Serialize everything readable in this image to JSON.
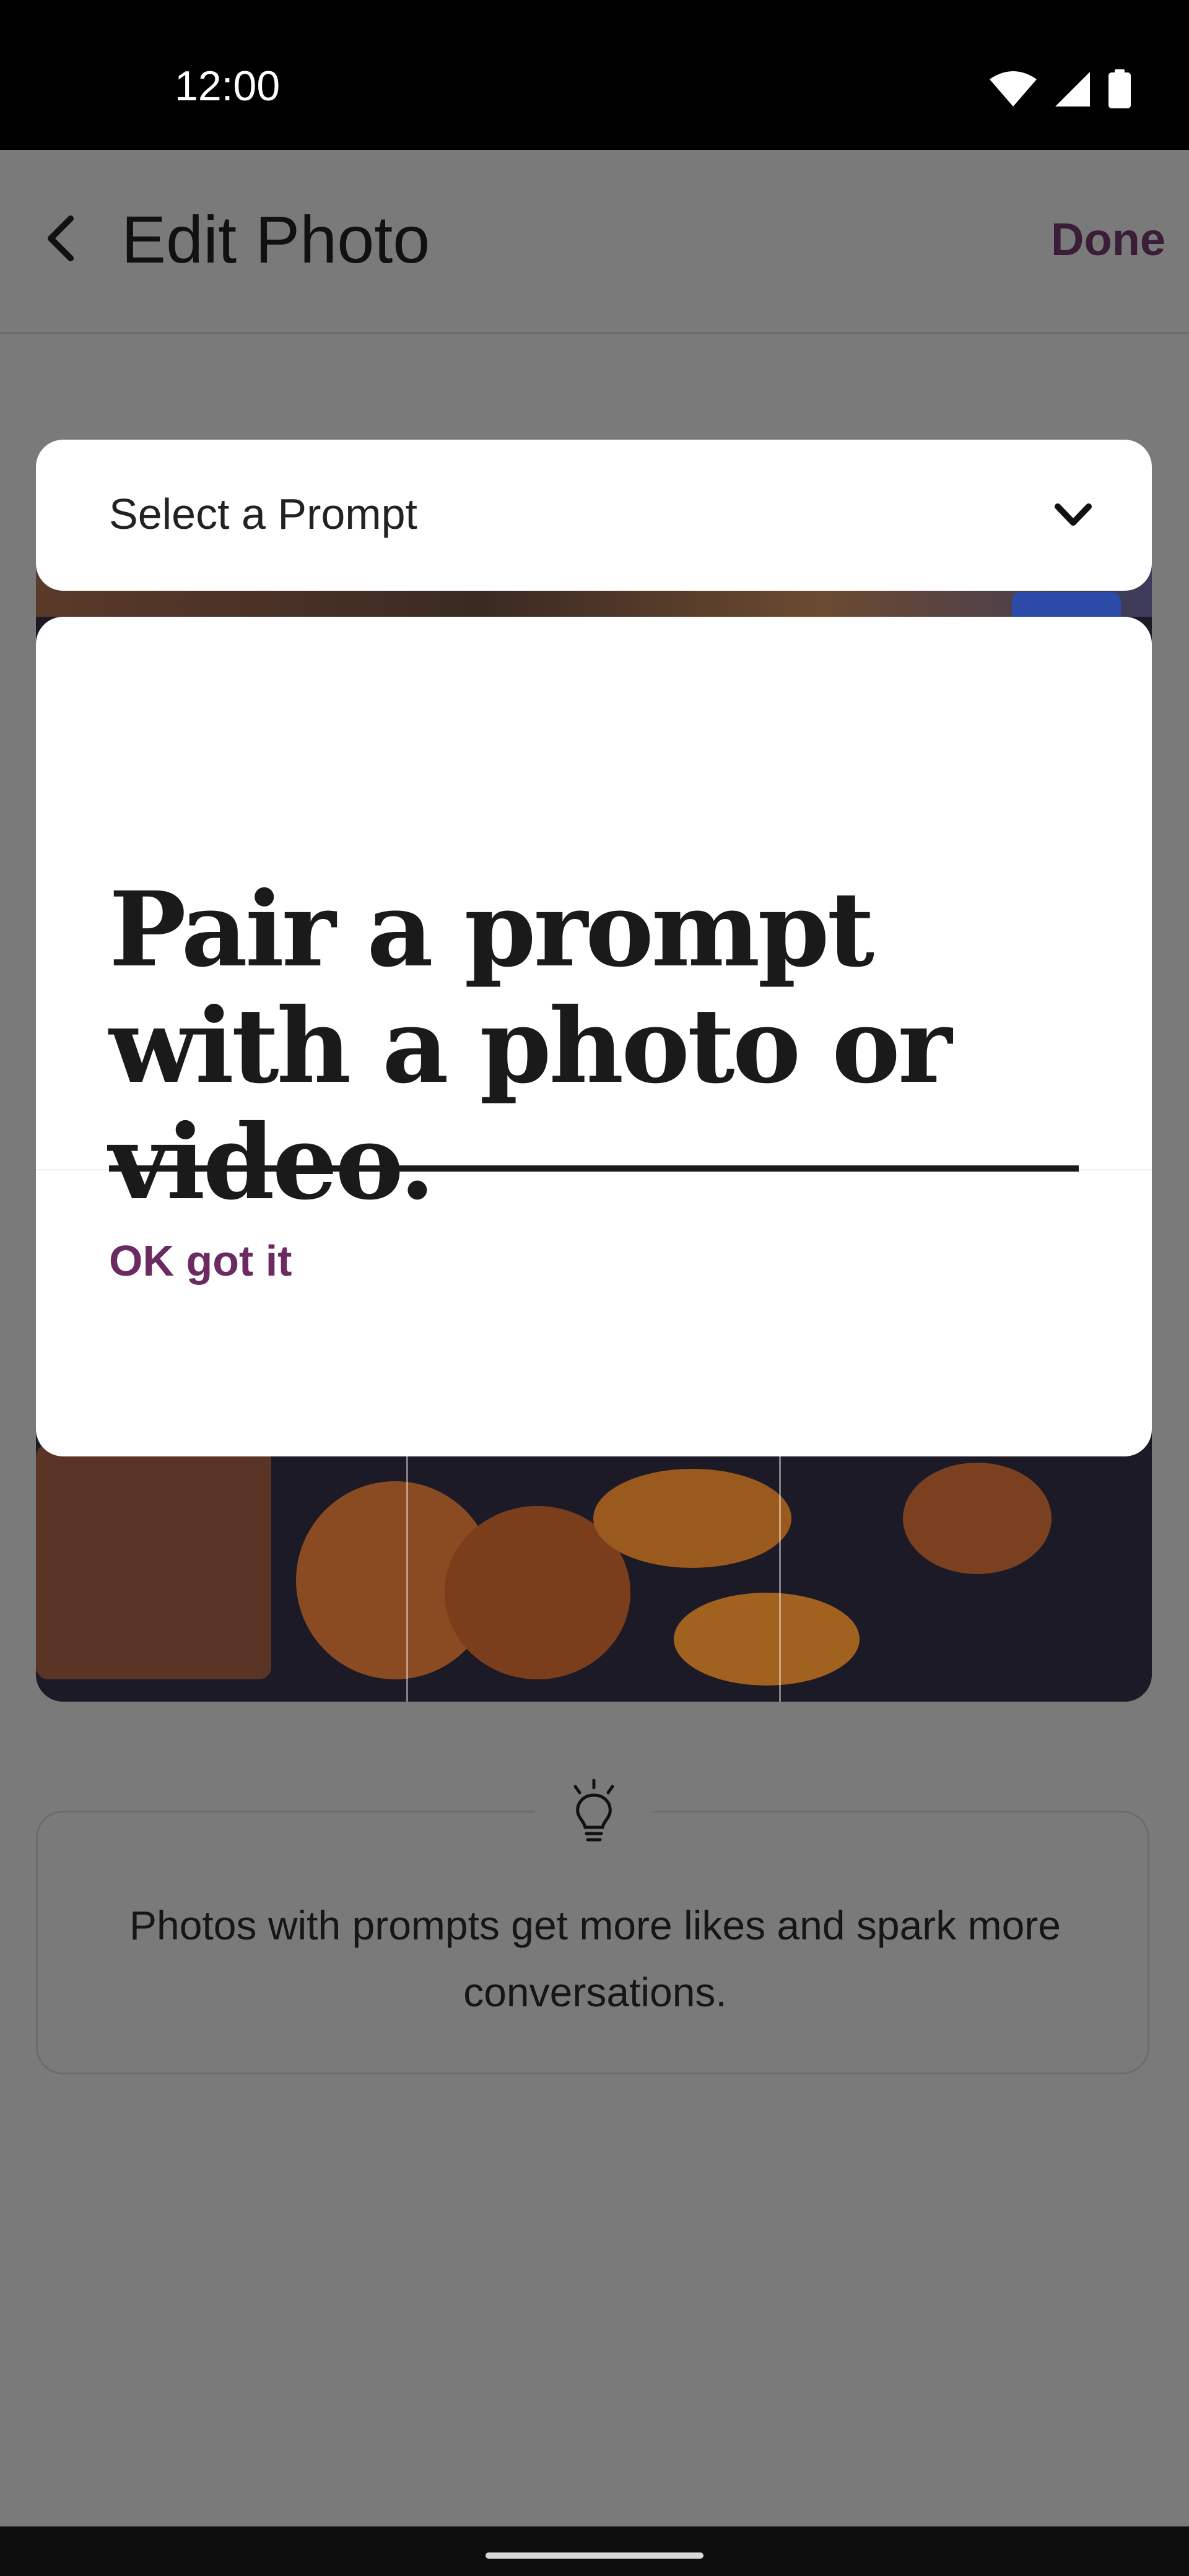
{
  "status_bar": {
    "time": "12:00",
    "icons": [
      "wifi-icon",
      "cell-signal-icon",
      "battery-icon"
    ]
  },
  "app_bar": {
    "title": "Edit Photo",
    "back_icon": "back-arrow-icon",
    "done_label": "Done"
  },
  "prompt_select": {
    "label": "Select a Prompt",
    "icon": "chevron-down-icon"
  },
  "modal": {
    "headline": "Pair a prompt with a photo or video.",
    "ok_label": "OK got it"
  },
  "tip": {
    "icon": "lightbulb-icon",
    "text": "Photos with prompts get more likes and spark more conversations."
  },
  "colors": {
    "accent": "#6b2a61",
    "done": "#3a1d36",
    "scrim": "#7a7a7a"
  }
}
